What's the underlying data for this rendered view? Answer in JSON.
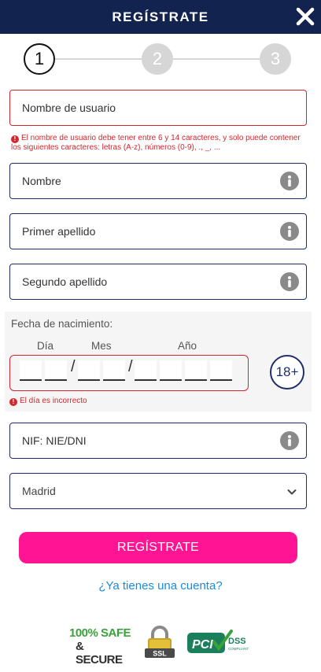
{
  "header": {
    "title": "REGÍSTRATE",
    "close_icon": "close-icon",
    "bg_color": "#13234f"
  },
  "stepper": {
    "steps": [
      "1",
      "2",
      "3"
    ],
    "active_step": 1
  },
  "form": {
    "username": {
      "label": "Nombre de usuario",
      "error": "El nombre de usuario debe tener entre 6 y 14 caracteres, y solo puede contener los siguientes caracteres: letras (A-z), números (0-9), ., _, ..."
    },
    "first_name": {
      "label": "Nombre",
      "icon": "info-icon"
    },
    "last_name_1": {
      "label": "Primer apellido",
      "icon": "info-icon"
    },
    "last_name_2": {
      "label": "Segundo apellido",
      "icon": "info-icon"
    },
    "birth_date": {
      "title": "Fecha de nacimiento:",
      "day_label": "Día",
      "month_label": "Mes",
      "year_label": "Año",
      "separator": "/",
      "age_badge": "18+",
      "error": "El día es incorrecto"
    },
    "nif": {
      "label": "NIF: NIE/DNI",
      "icon": "info-icon"
    },
    "province": {
      "selected": "Madrid",
      "icon": "chevron-down-icon"
    },
    "submit_label": "REGÍSTRATE",
    "login_link": "¿Ya tienes una cuenta?"
  },
  "badges": {
    "safe_line1": "100% SAFE",
    "safe_line2": "& SECURE",
    "ssl": "SSL",
    "pci": "PCI",
    "dss": "DSS",
    "dss_sub": "COMPLIANT"
  },
  "colors": {
    "accent_pink": "#ff1493",
    "error_red": "#d0282e",
    "navy": "#1f2e6b",
    "link_blue": "#1a8be0"
  }
}
